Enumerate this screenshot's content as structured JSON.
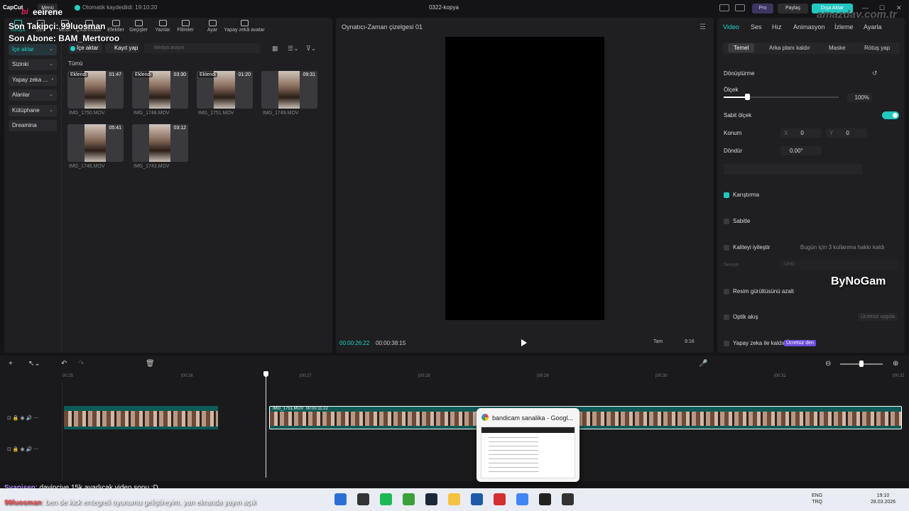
{
  "titlebar": {
    "app_logo": "CapCut",
    "menu": "Menü",
    "autosave": "Otomatik kaydedildi: 19:10:20",
    "project": "0322-kopya",
    "pro": "Pro",
    "share": "Paylaş",
    "export": "Dışa Aktar",
    "watermark": "amazday.com.tr"
  },
  "overlay": {
    "bi": "bi",
    "brand": "eeirene",
    "follower": "Son Takipçi: 99luosman",
    "subscriber": "Son Abone: BAM_Mertoroo"
  },
  "toolbar": [
    {
      "label": "Medya",
      "icon": "media-icon",
      "selected": true
    },
    {
      "label": "Ses",
      "icon": "audio-icon"
    },
    {
      "label": "Metin",
      "icon": "text-icon"
    },
    {
      "label": "Çıkartmalar",
      "icon": "sticker-icon"
    },
    {
      "label": "Efektler",
      "icon": "effects-icon"
    },
    {
      "label": "Geçişler",
      "icon": "transitions-icon"
    },
    {
      "label": "Yazılar",
      "icon": "captions-icon"
    },
    {
      "label": "Filtreler",
      "icon": "filters-icon"
    },
    {
      "label": "Ayar",
      "icon": "adjust-icon"
    },
    {
      "label": "Yapay zekâ avatar",
      "icon": "ai-avatar-icon"
    }
  ],
  "sidebar": {
    "items": [
      {
        "label": "İçe aktar",
        "chev": "⌄"
      },
      {
        "label": "Sizinki",
        "chev": "⌄"
      },
      {
        "label": "Yapay zeka ...",
        "chev": "•"
      },
      {
        "label": "Alanlar",
        "chev": "⌄"
      },
      {
        "label": "Kütüphane",
        "chev": "⌄"
      },
      {
        "label": "Dreamina",
        "chev": ""
      }
    ]
  },
  "media": {
    "import_btn": "İçe aktar",
    "record_btn": "Kayıt yap",
    "search_placeholder": "Medya arayın",
    "section": "Tümü",
    "items": [
      {
        "name": "IMG_1750.MOV",
        "duration": "01:47",
        "tag": "Eklendi"
      },
      {
        "name": "IMG_1748.MOV",
        "duration": "03:30",
        "tag": "Eklendi"
      },
      {
        "name": "IMG_1751.MOV",
        "duration": "01:20",
        "tag": "Eklendi"
      },
      {
        "name": "IMG_1749.MOV",
        "duration": "09:31",
        "tag": ""
      },
      {
        "name": "IMG_1746.MOV",
        "duration": "05:41",
        "tag": ""
      },
      {
        "name": "IMG_1743.MOV",
        "duration": "03:12",
        "tag": ""
      }
    ]
  },
  "player": {
    "title": "Oynatıcı-Zaman çizelgesi 01",
    "current": "00:00:26:22",
    "total": "00:00:38:15",
    "ratio": "9:16",
    "full": "Tam"
  },
  "right": {
    "tabs": [
      "Video",
      "Ses",
      "Hız",
      "Animasyon",
      "İzleme",
      "Ayarla"
    ],
    "subtabs": [
      "Temel",
      "Arka planı kaldır",
      "Maske",
      "Rötuş yap"
    ],
    "transform": "Dönüştürme",
    "scale": "Ölçek",
    "scale_value": "100%",
    "uniform_scale": "Sabit ölçek",
    "position": "Konum",
    "x_label": "X",
    "x_value": "0",
    "y_label": "Y",
    "y_value": "0",
    "rotate": "Döndür",
    "rotate_value": "0.00°",
    "blend": "Karıştırma",
    "stabilize": "Sabitle",
    "enhance": "Kaliteyi iyileştir",
    "enhance_limit": "Bugün için 3 kullanma hakkı kaldı",
    "level": "Seviye",
    "level_value": "UHD",
    "denoise": "Resim gürültüsünü azalt",
    "optical": "Optik akış",
    "try_free": "Ücretsiz uygula",
    "ai_remove": "Yapay zeka ile kaldır",
    "free_badge": "Ücretsiz den",
    "watermark2": "ByNoGam"
  },
  "timeline": {
    "ruler": [
      "00:25",
      "|00:26",
      "|00:27",
      "|00:28",
      "|00:29",
      "|00:30",
      "|00:31",
      "|00:32"
    ],
    "clip_label": "IMG_1751.MOV",
    "clip_duration": "00:00:11:22"
  },
  "popup": {
    "title": "bandicam sanalika - Googl..."
  },
  "chat": [
    {
      "user": "Syanisen",
      "msg": ": davinciye 15k ayarlıcak video sonu :D"
    },
    {
      "user": "99luosman",
      "msg": ": ben de kick entegreli oyunumu geliştireyim, yan ekranda yayın açık"
    }
  ],
  "taskbar": {
    "lang1": "ENG",
    "lang2": "TRQ",
    "time": "19:10",
    "date": "28.03.2026"
  }
}
